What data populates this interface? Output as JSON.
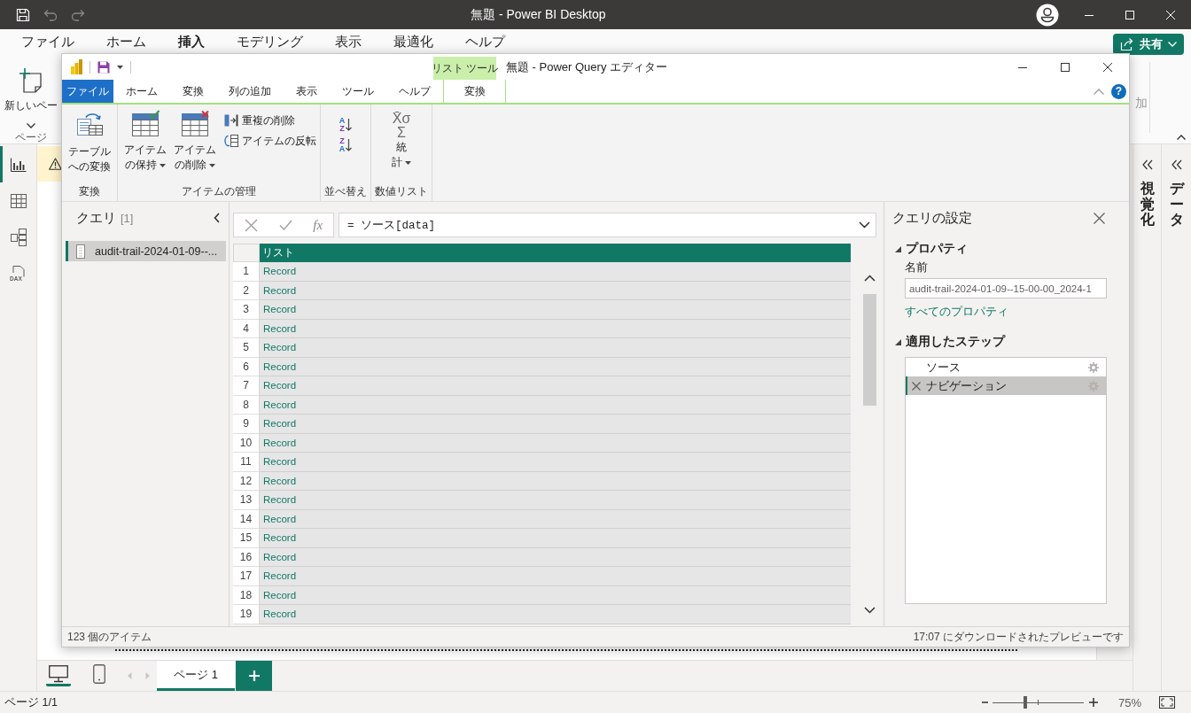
{
  "app_window": {
    "title": "無題 - Power BI Desktop"
  },
  "menu_tabs": [
    {
      "label": "ファイル",
      "selected": false
    },
    {
      "label": "ホーム",
      "selected": false
    },
    {
      "label": "挿入",
      "selected": true
    },
    {
      "label": "モデリング",
      "selected": false
    },
    {
      "label": "表示",
      "selected": false
    },
    {
      "label": "最適化",
      "selected": false
    },
    {
      "label": "ヘルプ",
      "selected": false
    }
  ],
  "share_button": {
    "label": "共有"
  },
  "ribbon": {
    "new_page": {
      "label": "新しいペー"
    },
    "group_label": "ページ",
    "cut_label": {
      "label": "加",
      "disabled": true
    }
  },
  "nav_rail": [
    {
      "kind": "report",
      "selected": true
    },
    {
      "kind": "table",
      "selected": false
    },
    {
      "kind": "model",
      "selected": false
    },
    {
      "kind": "dax",
      "selected": false,
      "badge": "DAX"
    }
  ],
  "side_panes": [
    {
      "label": "視覚化"
    },
    {
      "label": "データ"
    }
  ],
  "page_bar": {
    "views": [
      {
        "kind": "desktop",
        "selected": true
      },
      {
        "kind": "phone",
        "selected": false
      }
    ],
    "pages": [
      {
        "label": "ページ 1",
        "selected": true
      }
    ]
  },
  "status_bar": {
    "page_info": "ページ 1/1",
    "zoom": {
      "level": 0.36
    },
    "zoom_reading": "75%"
  },
  "editor": {
    "title": "無題 - Power Query エディター",
    "context_group": "リスト ツール",
    "tabs": [
      {
        "label": "ファイル",
        "kind": "file",
        "selected": false
      },
      {
        "label": "ホーム",
        "kind": "normal",
        "selected": false
      },
      {
        "label": "変換",
        "kind": "normal",
        "selected": false
      },
      {
        "label": "列の追加",
        "kind": "normal",
        "selected": false
      },
      {
        "label": "表示",
        "kind": "normal",
        "selected": false
      },
      {
        "label": "ツール",
        "kind": "normal",
        "selected": false
      },
      {
        "label": "ヘルプ",
        "kind": "normal",
        "selected": false
      },
      {
        "label": "変換",
        "kind": "context",
        "selected": true
      }
    ],
    "help": "?",
    "ribbon_groups": [
      {
        "label": "変換",
        "buttons": [
          {
            "kind": "large",
            "label": "テーブルへの変換",
            "dropdown": false
          }
        ]
      },
      {
        "label": "アイテムの管理",
        "buttons": [
          {
            "kind": "large",
            "label": "アイテムの保持",
            "dropdown": true
          },
          {
            "kind": "large",
            "label": "アイテムの削除",
            "dropdown": true
          },
          {
            "kind": "small",
            "label": "重複の削除"
          },
          {
            "kind": "small",
            "label": "アイテムの反転"
          }
        ]
      },
      {
        "label": "並べ替え",
        "buttons": [
          {
            "kind": "sort_ascending",
            "letters": [
              "A",
              "Z"
            ]
          },
          {
            "kind": "sort_descending",
            "letters": [
              "Z",
              "A"
            ]
          }
        ]
      },
      {
        "label": "数値リスト",
        "buttons": [
          {
            "kind": "stats",
            "symbols": [
              "X̄σ",
              "Σ"
            ],
            "label": "統計",
            "dropdown": true
          }
        ]
      }
    ],
    "query_pane": {
      "title": "クエリ",
      "count": "[1]",
      "items": [
        {
          "name": "audit-trail-2024-01-09--...",
          "selected": true
        }
      ]
    },
    "formula": {
      "fx": "fx",
      "text": "= ソース[data]"
    },
    "grid": {
      "columns": [
        {
          "label": "リスト",
          "selected": true
        }
      ],
      "rows": [
        {
          "number": "1",
          "value": "Record"
        },
        {
          "number": "2",
          "value": "Record"
        },
        {
          "number": "3",
          "value": "Record"
        },
        {
          "number": "4",
          "value": "Record"
        },
        {
          "number": "5",
          "value": "Record"
        },
        {
          "number": "6",
          "value": "Record"
        },
        {
          "number": "7",
          "value": "Record"
        },
        {
          "number": "8",
          "value": "Record"
        },
        {
          "number": "9",
          "value": "Record"
        },
        {
          "number": "10",
          "value": "Record"
        },
        {
          "number": "11",
          "value": "Record"
        },
        {
          "number": "12",
          "value": "Record"
        },
        {
          "number": "13",
          "value": "Record"
        },
        {
          "number": "14",
          "value": "Record"
        },
        {
          "number": "15",
          "value": "Record"
        },
        {
          "number": "16",
          "value": "Record"
        },
        {
          "number": "17",
          "value": "Record"
        },
        {
          "number": "18",
          "value": "Record"
        },
        {
          "number": "19",
          "value": "Record"
        }
      ]
    },
    "settings": {
      "title": "クエリの設定",
      "properties": {
        "heading": "プロパティ",
        "expanded": true,
        "name_label": "名前",
        "name_value": "audit-trail-2024-01-09--15-00-00_2024-1",
        "link": "すべてのプロパティ"
      },
      "steps": {
        "heading": "適用したステップ",
        "expanded": true,
        "items": [
          {
            "label": "ソース",
            "selected": false
          },
          {
            "label": "ナビゲーション",
            "selected": true
          }
        ]
      }
    },
    "status": {
      "items": "123 個のアイテム",
      "preview": "17:07 にダウンロードされたプレビューです"
    }
  }
}
